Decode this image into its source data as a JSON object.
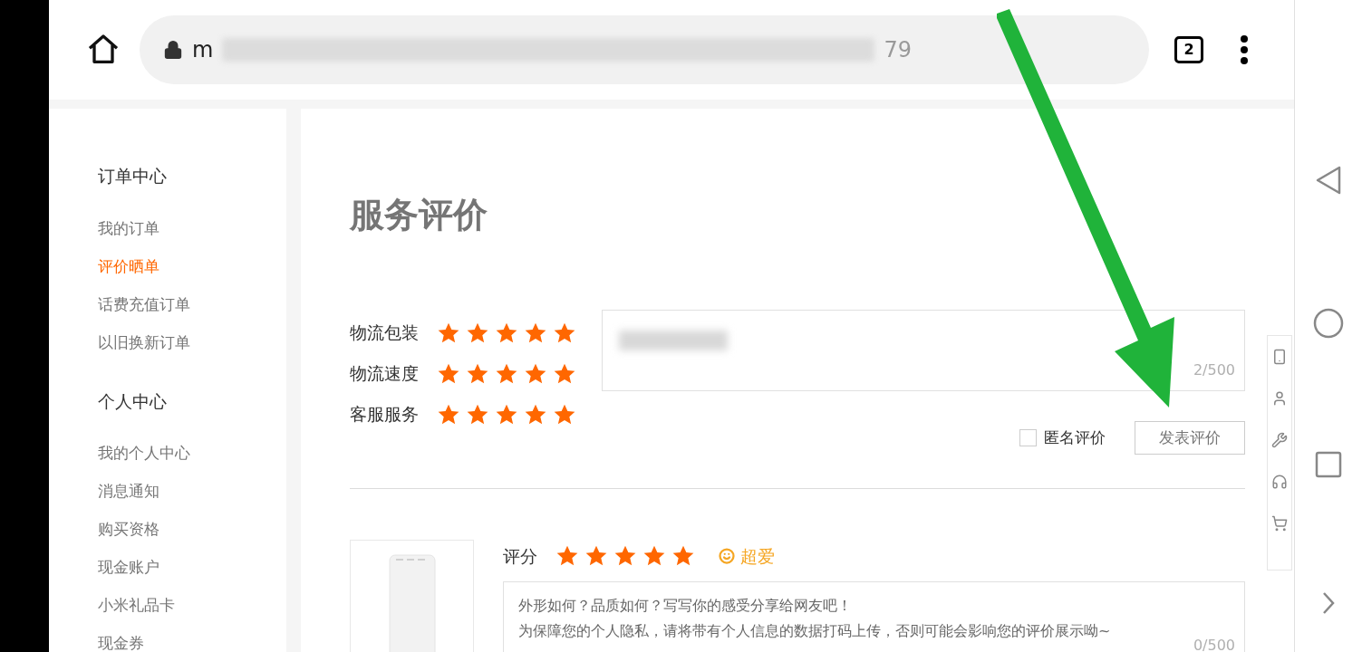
{
  "browser": {
    "url_start": "m",
    "url_end": "79",
    "tab_count": "2"
  },
  "sidebar": {
    "sections": [
      {
        "title": "订单中心",
        "items": [
          {
            "label": "我的订单",
            "selected": false
          },
          {
            "label": "评价晒单",
            "selected": true
          },
          {
            "label": "话费充值订单",
            "selected": false
          },
          {
            "label": "以旧换新订单",
            "selected": false
          }
        ]
      },
      {
        "title": "个人中心",
        "items": [
          {
            "label": "我的个人中心",
            "selected": false
          },
          {
            "label": "消息通知",
            "selected": false
          },
          {
            "label": "购买资格",
            "selected": false
          },
          {
            "label": "现金账户",
            "selected": false
          },
          {
            "label": "小米礼品卡",
            "selected": false
          },
          {
            "label": "现金券",
            "selected": false
          }
        ]
      }
    ]
  },
  "page_title": "服务评价",
  "service_ratings": [
    {
      "label": "物流包装",
      "stars": 5
    },
    {
      "label": "物流速度",
      "stars": 5
    },
    {
      "label": "客服服务",
      "stars": 5
    }
  ],
  "service_comment": {
    "counter": "2/500"
  },
  "anonymous": {
    "label": "匿名评价",
    "checked": false
  },
  "submit_button": "发表评价",
  "product_review": {
    "score_label": "评分",
    "stars": 5,
    "mood": "超爱",
    "placeholder_lines": [
      "外形如何？品质如何？写写你的感受分享给网友吧！",
      "为保障您的个人隐私，请将带有个人信息的数据打码上传，否则可能会影响您的评价展示呦~"
    ],
    "counter": "0/500"
  }
}
